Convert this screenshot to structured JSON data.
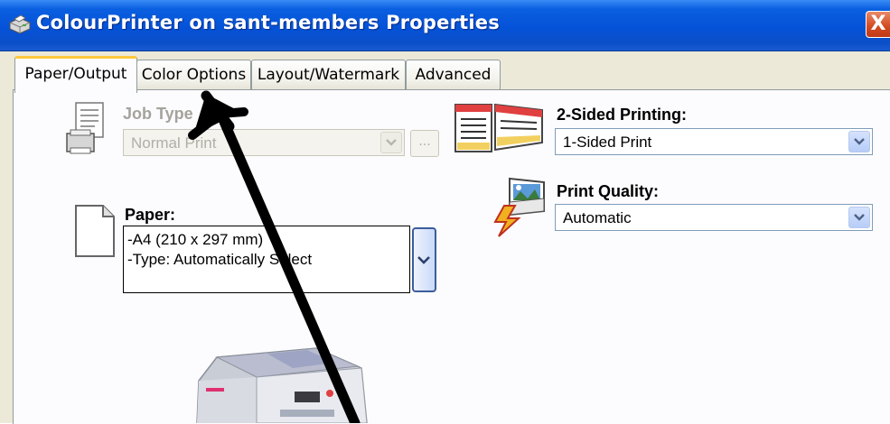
{
  "window": {
    "title": "ColourPrinter on sant-members Properties",
    "close_label": "X"
  },
  "tabs": [
    {
      "label": "Paper/Output",
      "active": true
    },
    {
      "label": "Color Options",
      "active": false
    },
    {
      "label": "Layout/Watermark",
      "active": false
    },
    {
      "label": "Advanced",
      "active": false
    }
  ],
  "job_type": {
    "label": "Job Type",
    "value": "Normal Print",
    "disabled": true,
    "ellipsis_label": "..."
  },
  "two_sided": {
    "label": "2-Sided Printing:",
    "value": "1-Sided Print"
  },
  "print_quality": {
    "label": "Print Quality:",
    "value": "Automatic"
  },
  "paper": {
    "label": "Paper:",
    "lines": [
      "-A4 (210 x 297 mm)",
      "-Type: Automatically Select"
    ]
  },
  "colors": {
    "titlebar": "#0552d8",
    "dialog_bg": "#ece9d8",
    "active_tab_accent": "#ffc83c",
    "close_button": "#d24a20"
  }
}
